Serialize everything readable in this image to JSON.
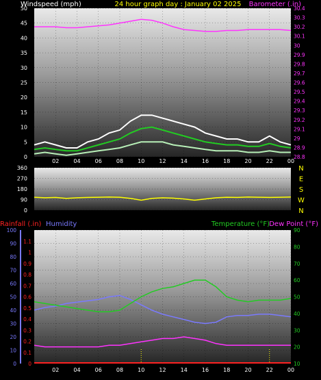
{
  "header": {
    "title": "24 hour graph day : January 02 2025",
    "wind_label": "Windspeed (mph)",
    "baro_label": "Barometer (.in)",
    "rain_label": "Rainfall (.in)",
    "hum_label": "Humidity",
    "temp_label": "Temperature (°F)",
    "dew_label": "Dew Point (°F)"
  },
  "colors": {
    "windspeed": "#ffffff",
    "wind_avg": "#22cc22",
    "wind_low": "#b8f0b8",
    "barometer": "#ff33ff",
    "direction": "#ffff00",
    "rainfall": "#ff2222",
    "humidity": "#7a7aff",
    "temperature": "#22cc22",
    "dewpoint": "#ff33ff",
    "title": "#ffff00",
    "axis_left": "#ffffff"
  },
  "chart_data": [
    {
      "type": "line",
      "name": "wind-barometer",
      "x_ticks": [
        "02",
        "04",
        "06",
        "08",
        "10",
        "12",
        "14",
        "16",
        "18",
        "20",
        "22",
        "00"
      ],
      "ylim": [
        0,
        50
      ],
      "yticks": [
        0,
        5,
        10,
        15,
        20,
        25,
        30,
        35,
        40,
        45,
        50
      ],
      "y2lim": [
        28.8,
        30.4
      ],
      "y2ticks": [
        "28.8",
        "28.9",
        "29",
        "29.1",
        "29.2",
        "29.3",
        "29.4",
        "29.5",
        "29.6",
        "29.7",
        "29.8",
        "29.9",
        "30",
        "30.1",
        "30.2",
        "30.3",
        "30.4"
      ],
      "x": [
        0,
        1,
        2,
        3,
        4,
        5,
        6,
        7,
        8,
        9,
        10,
        11,
        12,
        13,
        14,
        15,
        16,
        17,
        18,
        19,
        20,
        21,
        22,
        23,
        24
      ],
      "windspeed_gust": [
        4,
        5,
        4,
        3,
        3,
        5,
        6,
        8,
        9,
        12,
        14,
        14,
        13,
        12,
        11,
        10,
        8,
        7,
        6,
        6,
        5,
        5,
        7,
        5,
        4
      ],
      "windspeed_avg": [
        2.5,
        3,
        2.5,
        2,
        2,
        3,
        4,
        5,
        6,
        8,
        9.5,
        10,
        9,
        8,
        7,
        6,
        5,
        4.5,
        4,
        4,
        3.5,
        3.5,
        4.5,
        3.5,
        3
      ],
      "windspeed_low": [
        1,
        1.5,
        1,
        0.5,
        1,
        1.5,
        2,
        2.5,
        3,
        4,
        5,
        5,
        5,
        4,
        3.5,
        3,
        2.5,
        2,
        2,
        2,
        1.5,
        1.5,
        2,
        1.5,
        1.5
      ],
      "barometer": [
        30.2,
        30.2,
        30.2,
        30.19,
        30.19,
        30.2,
        30.21,
        30.22,
        30.24,
        30.26,
        30.28,
        30.27,
        30.24,
        30.2,
        30.17,
        30.16,
        30.15,
        30.15,
        30.16,
        30.16,
        30.17,
        30.17,
        30.17,
        30.17,
        30.16
      ]
    },
    {
      "type": "line",
      "name": "wind-direction",
      "ylim": [
        0,
        360
      ],
      "yticks": [
        0,
        90,
        180,
        270,
        360
      ],
      "right_labels": [
        "N",
        "W",
        "S",
        "E",
        "N"
      ],
      "x": [
        0,
        1,
        2,
        3,
        4,
        5,
        6,
        7,
        8,
        9,
        10,
        11,
        12,
        13,
        14,
        15,
        16,
        17,
        18,
        19,
        20,
        21,
        22,
        23,
        24
      ],
      "direction": [
        110,
        105,
        108,
        100,
        105,
        108,
        110,
        112,
        110,
        100,
        85,
        100,
        105,
        102,
        95,
        85,
        95,
        105,
        110,
        108,
        112,
        110,
        108,
        110,
        112
      ]
    },
    {
      "type": "line",
      "name": "rain-humidity-temp",
      "x_ticks": [
        "02",
        "04",
        "06",
        "08",
        "10",
        "12",
        "14",
        "16",
        "18",
        "20",
        "22",
        "00"
      ],
      "humidity_lim": [
        0,
        100
      ],
      "humidity_ticks": [
        0,
        10,
        20,
        30,
        40,
        50,
        60,
        70,
        80,
        90,
        100
      ],
      "rain_lim": [
        0,
        1.2
      ],
      "rain_ticks": [
        "0",
        "0.1",
        "0.2",
        "0.3",
        "0.4",
        "0.5",
        "0.6",
        "0.7",
        "0.8",
        "0.9",
        "1",
        "1.1"
      ],
      "temp_lim": [
        10,
        90
      ],
      "temp_ticks": [
        10,
        20,
        30,
        40,
        50,
        60,
        70,
        80,
        90
      ],
      "x": [
        0,
        1,
        2,
        3,
        4,
        5,
        6,
        7,
        8,
        9,
        10,
        11,
        12,
        13,
        14,
        15,
        16,
        17,
        18,
        19,
        20,
        21,
        22,
        23,
        24
      ],
      "rainfall": [
        0,
        0,
        0,
        0,
        0,
        0,
        0,
        0,
        0,
        0,
        0,
        0,
        0,
        0,
        0,
        0,
        0,
        0,
        0,
        0,
        0,
        0,
        0,
        0,
        0
      ],
      "humidity": [
        40,
        42,
        43,
        45,
        46,
        47,
        48,
        50,
        51,
        48,
        44,
        40,
        37,
        35,
        33,
        31,
        30,
        31,
        35,
        36,
        36,
        37,
        37,
        36,
        35
      ],
      "temperature": [
        47,
        46,
        45,
        44,
        43,
        42,
        41,
        41,
        42,
        46,
        50,
        53,
        55,
        56,
        58,
        60,
        60,
        56,
        50,
        48,
        47,
        48,
        48,
        48,
        49
      ],
      "dewpoint": [
        21,
        20,
        20,
        20,
        20,
        20,
        20,
        21,
        21,
        22,
        23,
        24,
        25,
        25,
        26,
        25,
        24,
        22,
        21,
        21,
        21,
        21,
        21,
        21,
        21
      ]
    }
  ]
}
